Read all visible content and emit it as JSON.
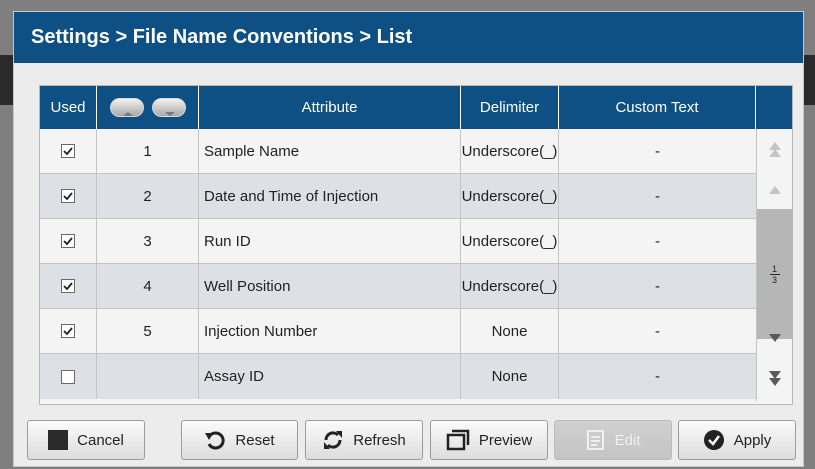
{
  "title": "Settings > File Name Conventions > List",
  "table": {
    "headers": {
      "used": "Used",
      "attribute": "Attribute",
      "delimiter": "Delimiter",
      "custom_text": "Custom Text"
    },
    "rows": [
      {
        "checked": true,
        "order": "1",
        "attribute": "Sample Name",
        "delimiter": "Underscore(_)",
        "custom_text": "-"
      },
      {
        "checked": true,
        "order": "2",
        "attribute": "Date and Time of Injection",
        "delimiter": "Underscore(_)",
        "custom_text": "-"
      },
      {
        "checked": true,
        "order": "3",
        "attribute": "Run ID",
        "delimiter": "Underscore(_)",
        "custom_text": "-"
      },
      {
        "checked": true,
        "order": "4",
        "attribute": "Well Position",
        "delimiter": "Underscore(_)",
        "custom_text": "-"
      },
      {
        "checked": true,
        "order": "5",
        "attribute": "Injection Number",
        "delimiter": "None",
        "custom_text": "-"
      },
      {
        "checked": false,
        "order": "",
        "attribute": "Assay ID",
        "delimiter": "None",
        "custom_text": "-"
      }
    ],
    "page": {
      "current": "1",
      "total": "3"
    }
  },
  "buttons": {
    "cancel": "Cancel",
    "reset": "Reset",
    "refresh": "Refresh",
    "preview": "Preview",
    "edit": "Edit",
    "apply": "Apply"
  },
  "colors": {
    "header": "#0e5083",
    "row_alt": "#dde1e6"
  }
}
